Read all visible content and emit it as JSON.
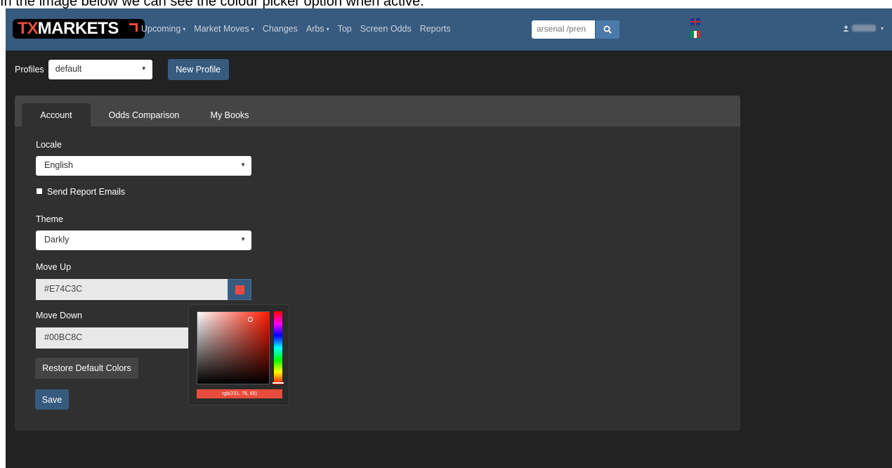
{
  "caption": "In the image below we can see the colour picker option when active:",
  "navbar": {
    "logo_tx": "TX",
    "logo_rest": "MARKETS",
    "items": [
      {
        "label": "Upcoming",
        "dropdown": true
      },
      {
        "label": "Market Moves",
        "dropdown": true
      },
      {
        "label": "Changes",
        "dropdown": false
      },
      {
        "label": "Arbs",
        "dropdown": true
      },
      {
        "label": "Top",
        "dropdown": false
      },
      {
        "label": "Screen Odds",
        "dropdown": false
      },
      {
        "label": "Reports",
        "dropdown": false
      }
    ],
    "search_value": "arsenal /pren",
    "user_caret": "▾"
  },
  "profiles": {
    "label": "Profiles",
    "selected": "default",
    "new_button": "New Profile"
  },
  "tabs": [
    "Account",
    "Odds Comparison",
    "My Books"
  ],
  "account": {
    "locale_label": "Locale",
    "locale_value": "English",
    "send_report_label": "Send Report Emails",
    "theme_label": "Theme",
    "theme_value": "Darkly",
    "move_up_label": "Move Up",
    "move_up_value": "#E74C3C",
    "move_down_label": "Move Down",
    "move_down_value": "#00BC8C",
    "restore_button": "Restore Default Colors",
    "save_button": "Save"
  },
  "picker": {
    "value_text": "rgb(231, 76, 60)"
  },
  "colors": {
    "move_up": "#e74c3c",
    "move_down": "#00bc8c",
    "hue_base": "#ff1a00",
    "accent": "#375a7f"
  }
}
